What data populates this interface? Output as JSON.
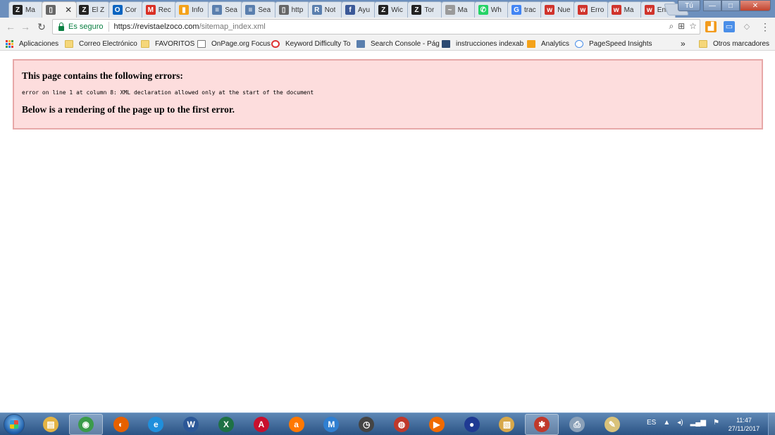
{
  "tabs": [
    {
      "label": "Ma",
      "icon": "z-icon",
      "color": "#222222",
      "glyph": "Z"
    },
    {
      "label": "",
      "icon": "document-icon",
      "color": "#666666",
      "glyph": "▯",
      "active": true
    },
    {
      "label": "El Z",
      "icon": "z-icon",
      "color": "#222222",
      "glyph": "Z"
    },
    {
      "label": "Cor",
      "icon": "outlook-icon",
      "color": "#0a64c0",
      "glyph": "O"
    },
    {
      "label": "Rec",
      "icon": "gmail-icon",
      "color": "#d93025",
      "glyph": "M"
    },
    {
      "label": "Info",
      "icon": "analytics-icon",
      "color": "#f4a21a",
      "glyph": "▮"
    },
    {
      "label": "Sea",
      "icon": "search-console-icon",
      "color": "#5a7fae",
      "glyph": "≡"
    },
    {
      "label": "Sea",
      "icon": "search-console-icon",
      "color": "#5a7fae",
      "glyph": "≡"
    },
    {
      "label": "http",
      "icon": "document-icon",
      "color": "#666666",
      "glyph": "▯"
    },
    {
      "label": "Not",
      "icon": "onpage-icon",
      "color": "#5a7fae",
      "glyph": "R"
    },
    {
      "label": "Ayu",
      "icon": "facebook-icon",
      "color": "#3b5998",
      "glyph": "f"
    },
    {
      "label": "Wic",
      "icon": "z-icon",
      "color": "#222222",
      "glyph": "Z"
    },
    {
      "label": "Tor",
      "icon": "z-icon",
      "color": "#222222",
      "glyph": "Z"
    },
    {
      "label": "Ma",
      "icon": "cloud-icon",
      "color": "#9a9a9a",
      "glyph": "~"
    },
    {
      "label": "Wh",
      "icon": "whatsapp-icon",
      "color": "#25d366",
      "glyph": "✆"
    },
    {
      "label": "trac",
      "icon": "google-icon",
      "color": "#4285f4",
      "glyph": "G"
    },
    {
      "label": "Nue",
      "icon": "w-icon",
      "color": "#d0342c",
      "glyph": "w"
    },
    {
      "label": "Erro",
      "icon": "w-icon",
      "color": "#d0342c",
      "glyph": "w"
    },
    {
      "label": "Ma",
      "icon": "w-icon",
      "color": "#d0342c",
      "glyph": "w"
    },
    {
      "label": "Ena",
      "icon": "w-icon",
      "color": "#d0342c",
      "glyph": "w"
    }
  ],
  "window": {
    "user_label": "Tú",
    "min": "—",
    "max": "□",
    "close": "✕"
  },
  "toolbar": {
    "back": "←",
    "forward": "→",
    "reload": "↻",
    "secure_label": "Es seguro",
    "url_host": "https://revistaelzoco.com",
    "url_path": "/sitemap_index.xml",
    "zoom_icon": "⌕",
    "translate_icon": "⊞",
    "star_icon": "☆",
    "menu_icon": "⋮"
  },
  "bookmarks": [
    {
      "label": "Aplicaciones",
      "icon": "apps-icon"
    },
    {
      "label": "Correo Electrónico",
      "icon": "folder-icon"
    },
    {
      "label": "FAVORITOS",
      "icon": "folder-icon"
    },
    {
      "label": "OnPage.org Focus",
      "icon": "document-icon"
    },
    {
      "label": "Keyword Difficulty To",
      "icon": "circle-icon"
    },
    {
      "label": "Search Console - Pág",
      "icon": "search-console-icon"
    },
    {
      "label": "instrucciones indexab",
      "icon": "image-icon"
    },
    {
      "label": "Analytics",
      "icon": "analytics-icon"
    },
    {
      "label": "PageSpeed Insights",
      "icon": "pagespeed-icon"
    }
  ],
  "bookmarks_overflow": "»",
  "other_bookmarks": "Otros marcadores",
  "error": {
    "heading": "This page contains the following errors:",
    "message": "error on line 1 at column 8: XML declaration allowed only at the start of the document",
    "footer": "Below is a rendering of the page up to the first error."
  },
  "taskbar": {
    "apps": [
      {
        "icon": "explorer-icon",
        "color": "#e3b344",
        "glyph": "▤"
      },
      {
        "icon": "chrome-icon",
        "color": "#3b9b4a",
        "glyph": "◉",
        "active": true
      },
      {
        "icon": "firefox-icon",
        "color": "#e66000",
        "glyph": "◐"
      },
      {
        "icon": "internet-explorer-icon",
        "color": "#1f8fdc",
        "glyph": "e"
      },
      {
        "icon": "word-icon",
        "color": "#2b5797",
        "glyph": "W"
      },
      {
        "icon": "excel-icon",
        "color": "#1e7145",
        "glyph": "X"
      },
      {
        "icon": "acrobat-icon",
        "color": "#c8102e",
        "glyph": "A"
      },
      {
        "icon": "avast-icon",
        "color": "#ff7800",
        "glyph": "a"
      },
      {
        "icon": "malwarebytes-icon",
        "color": "#2f7fd1",
        "glyph": "M"
      },
      {
        "icon": "clock-app-icon",
        "color": "#444444",
        "glyph": "◷"
      },
      {
        "icon": "red-app-icon",
        "color": "#c0392b",
        "glyph": "◍"
      },
      {
        "icon": "media-player-icon",
        "color": "#f06a00",
        "glyph": "▶"
      },
      {
        "icon": "people-icon",
        "color": "#1f3a93",
        "glyph": "●"
      },
      {
        "icon": "photo-viewer-icon",
        "color": "#d7a84a",
        "glyph": "▧"
      },
      {
        "icon": "paint-icon",
        "color": "#c0392b",
        "glyph": "✱",
        "active": true
      },
      {
        "icon": "printer-icon",
        "color": "#8aa0b8",
        "glyph": "⎙"
      },
      {
        "icon": "paint-palette-icon",
        "color": "#d9c27a",
        "glyph": "✎"
      }
    ],
    "language": "ES",
    "time": "11:47",
    "date": "27/11/2017"
  }
}
